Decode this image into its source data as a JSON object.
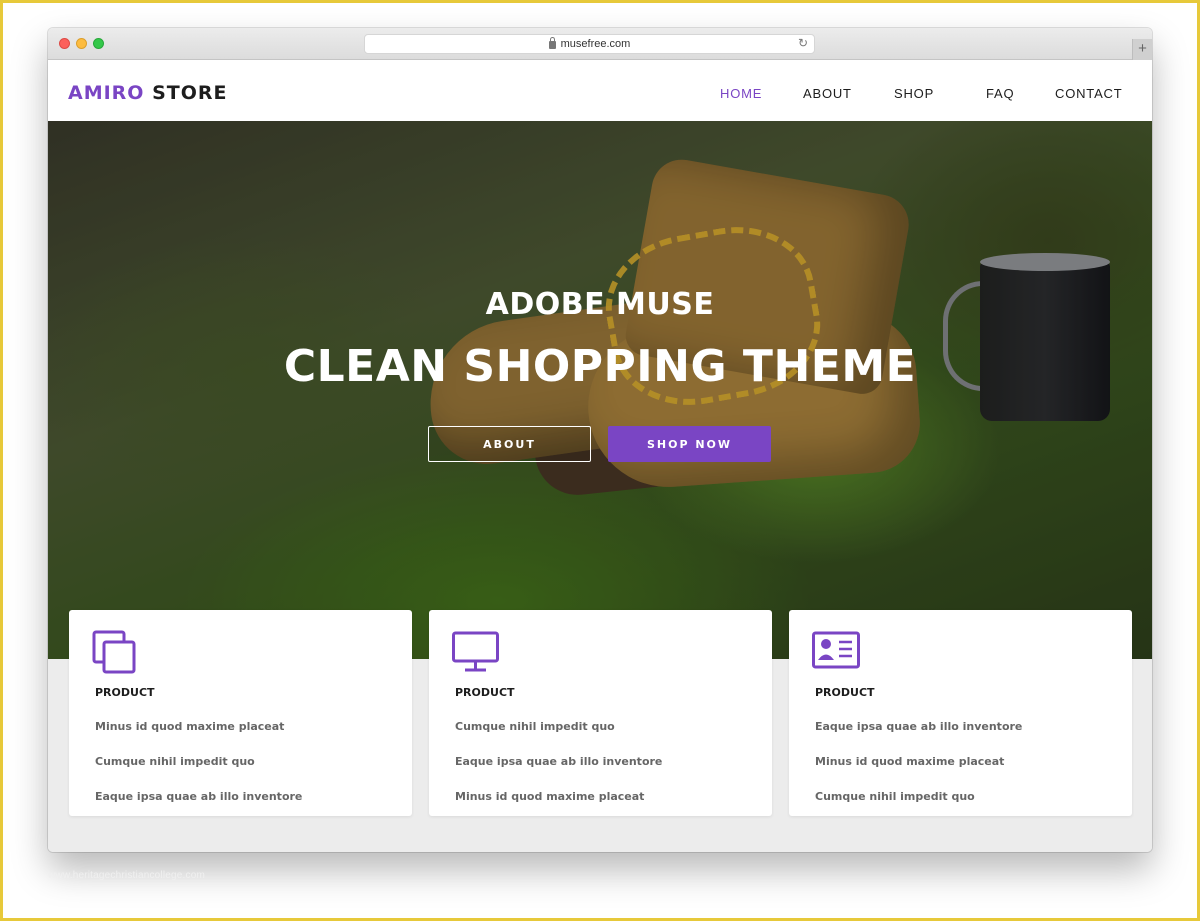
{
  "browser": {
    "url": "musefree.com",
    "new_tab_label": "+"
  },
  "header": {
    "logo_accent": "AMIRO",
    "logo_rest": "STORE",
    "nav": [
      {
        "label": "HOME",
        "active": true
      },
      {
        "label": "ABOUT",
        "active": false
      },
      {
        "label": "SHOP",
        "active": false
      },
      {
        "label": "FAQ",
        "active": false
      },
      {
        "label": "CONTACT",
        "active": false
      }
    ]
  },
  "hero": {
    "subtitle": "ADOBE MUSE",
    "title": "CLEAN SHOPPING THEME",
    "about_button": "ABOUT",
    "shop_button": "SHOP NOW"
  },
  "cards": [
    {
      "icon": "copy-icon",
      "title": "PRODUCT",
      "lines": [
        "Minus id quod maxime placeat",
        "Cumque nihil impedit quo",
        "Eaque ipsa quae ab illo inventore"
      ]
    },
    {
      "icon": "monitor-icon",
      "title": "PRODUCT",
      "lines": [
        "Cumque nihil impedit quo",
        "Eaque ipsa quae ab illo inventore",
        "Minus id quod maxime placeat"
      ]
    },
    {
      "icon": "id-card-icon",
      "title": "PRODUCT",
      "lines": [
        "Eaque ipsa quae ab illo inventore",
        "Minus id quod maxime placeat",
        "Cumque nihil impedit quo"
      ]
    }
  ],
  "watermark": "www.heritagechristiancollege.com",
  "colors": {
    "accent": "#7a45c4",
    "frame": "#e7c93a"
  }
}
